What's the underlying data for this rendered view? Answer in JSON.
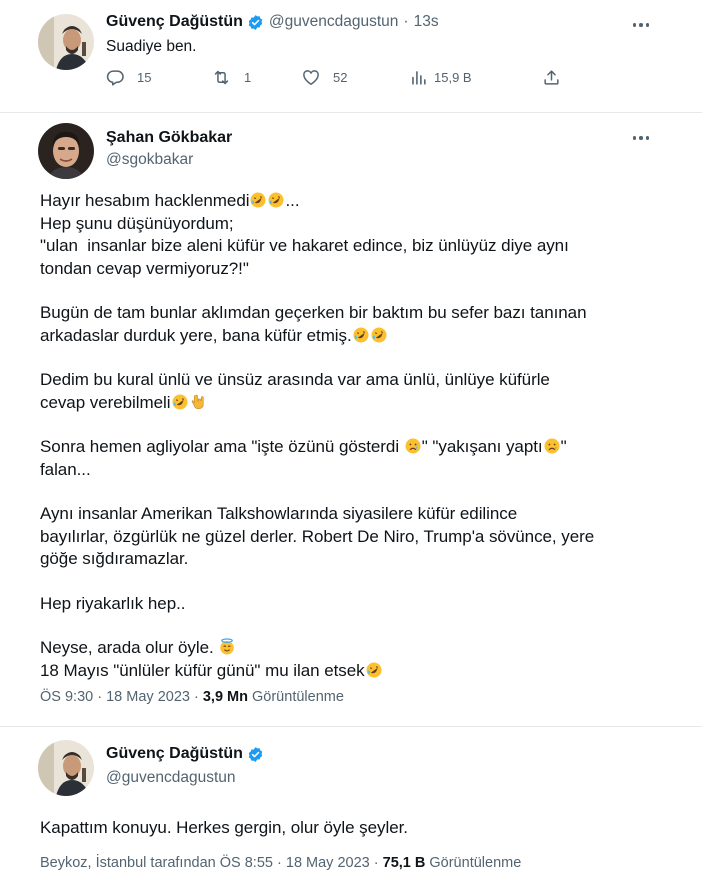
{
  "tweet1": {
    "name": "Güvenç Dağüstün",
    "handle": "@guvencdagustun",
    "sep": "·",
    "time": "13s",
    "text": "Suadiye ben.",
    "replies": "15",
    "retweets": "1",
    "likes": "52",
    "views": "15,9 B"
  },
  "tweet2": {
    "name": "Şahan Gökbakar",
    "handle": "@sgokbakar",
    "lines": [
      "Hayır hesabım hacklenmedi",
      "Hep şunu düşünüyordum;",
      "\"ulan  insanlar bize aleni küfür ve hakaret edince, biz ünlüyüz diye aynı",
      "tondan cevap vermiyoruz?!\"",
      "Bugün de tam bunlar aklımdan geçerken bir baktım bu sefer bazı tanınan",
      "arkadaslar durduk yere, bana küfür etmiş.",
      "Dedim bu kural ünlü ve ünsüz arasında var ama ünlü, ünlüye küfürle",
      "cevap verebilmeli",
      "Sonra hemen agliyolar ama \"işte özünü gösterdi ",
      "\" \"yakışanı yaptı",
      "\"",
      "falan...",
      "Aynı insanlar Amerikan Talkshowlarında siyasilere küfür edilince",
      "bayılırlar, özgürlük ne güzel derler. Robert De Niro, Trump'a sövünce, yere",
      "göğe sığdıramazlar.",
      "Hep riyakarlık hep..",
      "Neyse, arada olur öyle.",
      "18 Mayıs \"ünlüler küfür günü\" mu ilan etsek"
    ],
    "ellipsis": "...",
    "time": "ÖS 9:30",
    "sep": "·",
    "date": "18 May 2023",
    "views_count": "3,9 Mn",
    "views_label": "Görüntülenme"
  },
  "tweet3": {
    "name": "Güvenç Dağüstün",
    "handle": "@guvencdagustun",
    "text": "Kapattım konuyu. Herkes gergin, olur öyle şeyler.",
    "location": "Beykoz, İstanbul tarafından",
    "time": "ÖS 8:55",
    "sep": "·",
    "date": "18 May 2023",
    "views_count": "75,1 B",
    "views_label": "Görüntülenme"
  },
  "colors": {
    "verified": "#1d9bf0",
    "secondary_text": "#536471",
    "primary_text": "#0f1419",
    "divider": "#e6e9ec"
  },
  "icons": [
    "reply-icon",
    "retweet-icon",
    "like-icon",
    "views-icon",
    "share-icon",
    "verified-badge-icon",
    "more-options-icon",
    "rofl-emoji",
    "rock-hand-emoji",
    "crying-face-emoji",
    "halo-face-emoji"
  ]
}
